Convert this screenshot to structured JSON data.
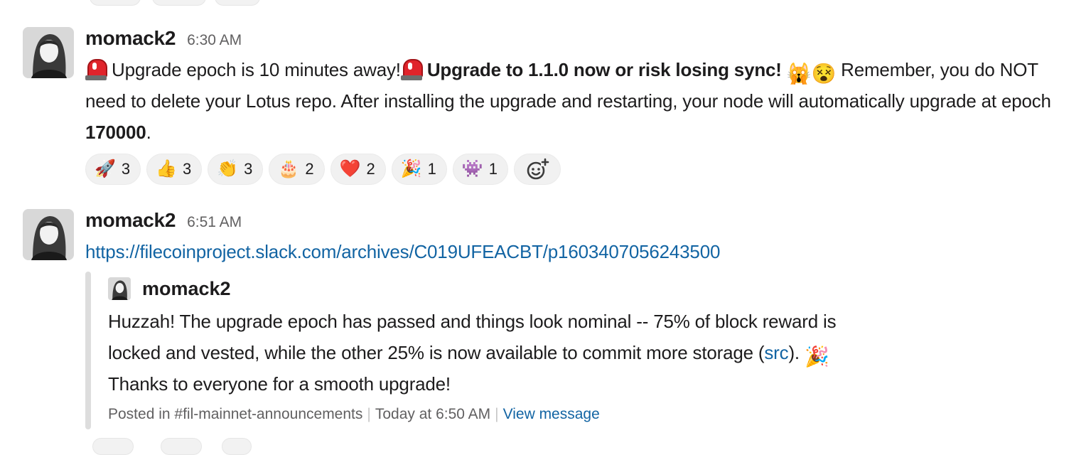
{
  "messages": [
    {
      "sender": "momack2",
      "time": "6:30 AM",
      "text": {
        "part1": "Upgrade epoch is 10 minutes away!",
        "bold1": "Upgrade to 1.1.0 now or risk losing sync!",
        "part2": "Remember, you do NOT need to delete your Lotus repo. After installing the upgrade and restarting, your node will automatically upgrade at epoch ",
        "bold2": "170000",
        "part3": "."
      },
      "emojis": [
        "rotating-light",
        "rotating-light",
        "scream-cat",
        "dizzy-face"
      ],
      "reactions": [
        {
          "emoji": "🚀",
          "icon": "rocket-icon",
          "count": "3"
        },
        {
          "emoji": "👍",
          "icon": "thumbsup-icon",
          "count": "3"
        },
        {
          "emoji": "👏",
          "icon": "clap-icon",
          "count": "3"
        },
        {
          "emoji": "🎂",
          "icon": "cake-icon",
          "count": "2"
        },
        {
          "emoji": "❤️",
          "icon": "heart-icon",
          "count": "2"
        },
        {
          "emoji": "🎉",
          "icon": "party-popper-icon",
          "count": "1"
        },
        {
          "emoji": "👾",
          "icon": "gopher-icon",
          "count": "1"
        }
      ]
    },
    {
      "sender": "momack2",
      "time": "6:51 AM",
      "link": "https://filecoinproject.slack.com/archives/C019UFEACBT/p1603407056243500",
      "quote": {
        "author": "momack2",
        "text_before_link": "Huzzah! The upgrade epoch has passed and things look nominal -- 75% of block reward is locked and vested, while the other 25% is now available to commit more storage (",
        "link_text": "src",
        "text_after_link": "). ",
        "text_end": " Thanks to everyone for a smooth upgrade!",
        "emoji": "🎉",
        "footer_channel": "Posted in #fil-mainnet-announcements",
        "footer_time": "Today at 6:50 AM",
        "footer_action": "View message"
      }
    }
  ],
  "colors": {
    "link": "#1264a3",
    "meta": "#616061",
    "reaction_bg": "#f1f1f1",
    "quote_bar": "#dddddd"
  }
}
